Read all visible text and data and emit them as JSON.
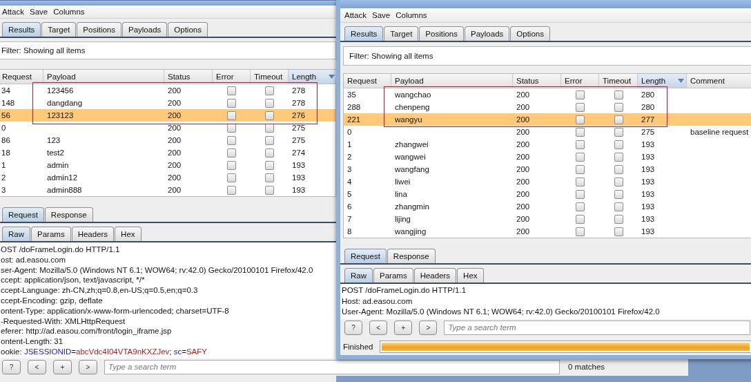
{
  "back_window": {
    "menu": [
      "Attack",
      "Save",
      "Columns"
    ],
    "tabs": [
      {
        "label": "Results",
        "selected": true
      },
      {
        "label": "Target",
        "selected": false
      },
      {
        "label": "Positions",
        "selected": false
      },
      {
        "label": "Payloads",
        "selected": false
      },
      {
        "label": "Options",
        "selected": false
      }
    ],
    "filter": "Filter:  Showing all items",
    "columns": [
      {
        "label": "Request",
        "sorted": false
      },
      {
        "label": "Payload",
        "sorted": false
      },
      {
        "label": "Status",
        "sorted": false
      },
      {
        "label": "Error",
        "sorted": false
      },
      {
        "label": "Timeout",
        "sorted": false
      },
      {
        "label": "Length",
        "sorted": true
      }
    ],
    "rows": [
      {
        "request": "34",
        "payload": "123456",
        "status": "200",
        "error": false,
        "timeout": false,
        "length": "278",
        "selected": false
      },
      {
        "request": "148",
        "payload": "dangdang",
        "status": "200",
        "error": false,
        "timeout": false,
        "length": "278",
        "selected": false
      },
      {
        "request": "56",
        "payload": "123123",
        "status": "200",
        "error": false,
        "timeout": false,
        "length": "276",
        "selected": true
      },
      {
        "request": "0",
        "status": "200",
        "error": false,
        "timeout": false,
        "length": "275",
        "selected": false
      },
      {
        "request": "86",
        "payload": "123",
        "status": "200",
        "error": false,
        "timeout": false,
        "length": "275",
        "selected": false
      },
      {
        "request": "18",
        "payload": "test2",
        "status": "200",
        "error": false,
        "timeout": false,
        "length": "274",
        "selected": false
      },
      {
        "request": "1",
        "payload": "admin",
        "status": "200",
        "error": false,
        "timeout": false,
        "length": "193",
        "selected": false
      },
      {
        "request": "2",
        "payload": "admin12",
        "status": "200",
        "error": false,
        "timeout": false,
        "length": "193",
        "selected": false
      },
      {
        "request": "3",
        "payload": "admin888",
        "status": "200",
        "error": false,
        "timeout": false,
        "length": "193",
        "selected": false
      }
    ],
    "message_tabs": [
      {
        "label": "Request",
        "selected": true
      },
      {
        "label": "Response",
        "selected": false
      }
    ],
    "view_tabs": [
      {
        "label": "Raw",
        "selected": true
      },
      {
        "label": "Params",
        "selected": false
      },
      {
        "label": "Headers",
        "selected": false
      },
      {
        "label": "Hex",
        "selected": false
      }
    ],
    "request_lines": [
      "OST /doFrameLogin.do HTTP/1.1",
      "ost: ad.easou.com",
      "ser-Agent: Mozilla/5.0 (Windows NT 6.1; WOW64; rv:42.0) Gecko/20100101 Firefox/42.0",
      "ccept: application/json, text/javascript, */*",
      "ccept-Language: zh-CN,zh;q=0.8,en-US;q=0.5,en;q=0.3",
      "ccept-Encoding: gzip, deflate",
      "ontent-Type: application/x-www-form-urlencoded; charset=UTF-8",
      "-Requested-With: XMLHttpRequest",
      "eferer: http://ad.easou.com/front/login_iframe.jsp",
      "ontent-Length: 31",
      {
        "segments": [
          {
            "text": "ookie: ",
            "kind": "plain"
          },
          {
            "text": "JSESSIONID",
            "kind": "key"
          },
          {
            "text": "=",
            "kind": "plain"
          },
          {
            "text": "abcVdc4I04VTA9nKXZJev",
            "kind": "value"
          },
          {
            "text": "; ",
            "kind": "plain"
          },
          {
            "text": "sc",
            "kind": "key"
          },
          {
            "text": "=",
            "kind": "plain"
          },
          {
            "text": "SAFY",
            "kind": "value"
          }
        ]
      }
    ],
    "search": {
      "buttons": [
        "?",
        "<",
        "+",
        ">"
      ],
      "placeholder": "Type a search term",
      "matches": "0 matches"
    }
  },
  "front_window": {
    "menu": [
      "Attack",
      "Save",
      "Columns"
    ],
    "tabs": [
      {
        "label": "Results",
        "selected": true
      },
      {
        "label": "Target",
        "selected": false
      },
      {
        "label": "Positions",
        "selected": false
      },
      {
        "label": "Payloads",
        "selected": false
      },
      {
        "label": "Options",
        "selected": false
      }
    ],
    "filter": "Filter:  Showing all items",
    "columns": [
      {
        "label": "Request",
        "sorted": false
      },
      {
        "label": "Payload",
        "sorted": false
      },
      {
        "label": "Status",
        "sorted": false
      },
      {
        "label": "Error",
        "sorted": false
      },
      {
        "label": "Timeout",
        "sorted": false
      },
      {
        "label": "Length",
        "sorted": true
      },
      {
        "label": "Comment",
        "sorted": false
      }
    ],
    "rows": [
      {
        "request": "35",
        "payload": "wangchao",
        "status": "200",
        "error": false,
        "timeout": false,
        "length": "280",
        "selected": false
      },
      {
        "request": "288",
        "payload": "chenpeng",
        "status": "200",
        "error": false,
        "timeout": false,
        "length": "280",
        "selected": false
      },
      {
        "request": "221",
        "payload": "wangyu",
        "status": "200",
        "error": false,
        "timeout": false,
        "length": "277",
        "selected": true
      },
      {
        "request": "0",
        "status": "200",
        "error": false,
        "timeout": false,
        "length": "275",
        "comment": "baseline request",
        "selected": false
      },
      {
        "request": "1",
        "payload": "zhangwei",
        "status": "200",
        "error": false,
        "timeout": false,
        "length": "193",
        "selected": false
      },
      {
        "request": "2",
        "payload": "wangwei",
        "status": "200",
        "error": false,
        "timeout": false,
        "length": "193",
        "selected": false
      },
      {
        "request": "3",
        "payload": "wangfang",
        "status": "200",
        "error": false,
        "timeout": false,
        "length": "193",
        "selected": false
      },
      {
        "request": "4",
        "payload": "liwei",
        "status": "200",
        "error": false,
        "timeout": false,
        "length": "193",
        "selected": false
      },
      {
        "request": "5",
        "payload": "lina",
        "status": "200",
        "error": false,
        "timeout": false,
        "length": "193",
        "selected": false
      },
      {
        "request": "6",
        "payload": "zhangmin",
        "status": "200",
        "error": false,
        "timeout": false,
        "length": "193",
        "selected": false
      },
      {
        "request": "7",
        "payload": "lijing",
        "status": "200",
        "error": false,
        "timeout": false,
        "length": "193",
        "selected": false
      },
      {
        "request": "8",
        "payload": "wangjing",
        "status": "200",
        "error": false,
        "timeout": false,
        "length": "193",
        "selected": false
      }
    ],
    "message_tabs": [
      {
        "label": "Request",
        "selected": true
      },
      {
        "label": "Response",
        "selected": false
      }
    ],
    "view_tabs": [
      {
        "label": "Raw",
        "selected": true
      },
      {
        "label": "Params",
        "selected": false
      },
      {
        "label": "Headers",
        "selected": false
      },
      {
        "label": "Hex",
        "selected": false
      }
    ],
    "request_lines": [
      "POST /doFrameLogin.do HTTP/1.1",
      "Host: ad.easou.com",
      "User-Agent: Mozilla/5.0 (Windows NT 6.1; WOW64; rv:42.0) Gecko/20100101 Firefox/42.0"
    ],
    "search": {
      "buttons": [
        "?",
        "<",
        "+",
        ">"
      ],
      "placeholder": "Type a search term"
    },
    "status": {
      "label": "Finished",
      "level": 1
    }
  }
}
